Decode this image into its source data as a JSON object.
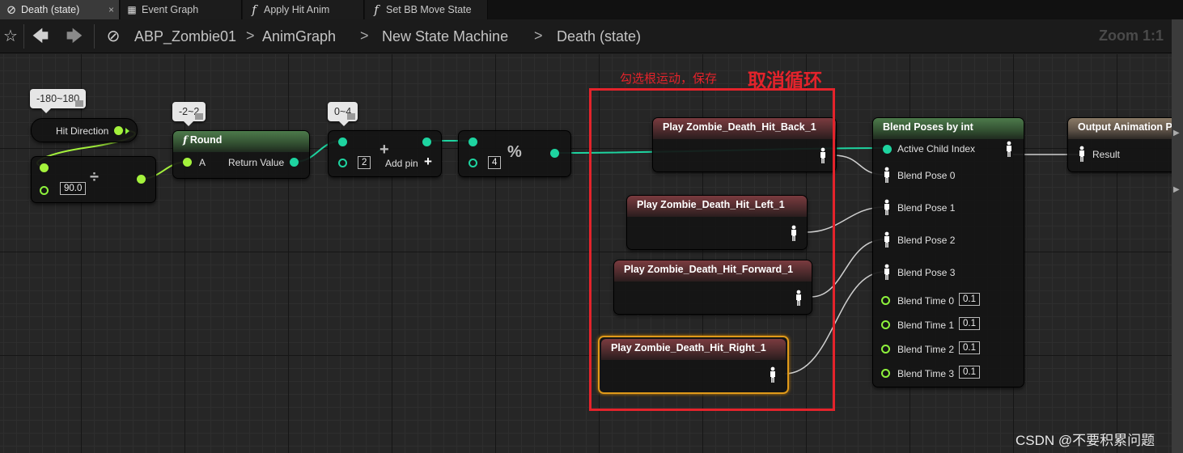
{
  "tabs": [
    {
      "label": "Death (state)",
      "icon": "state-icon",
      "active": true
    },
    {
      "label": "Event Graph",
      "icon": "event-graph-icon"
    },
    {
      "label": "Apply Hit Anim",
      "icon": "function-icon",
      "glyph": "f"
    },
    {
      "label": "Set BB Move State",
      "icon": "function-icon",
      "glyph": "f"
    }
  ],
  "breadcrumb": {
    "items": [
      "ABP_Zombie01",
      "AnimGraph",
      "New State Machine",
      "Death (state)"
    ],
    "separator": ">",
    "zoom": "Zoom 1:1"
  },
  "comments": {
    "direction_range": "-180~180",
    "round_range": "-2~2",
    "add_range": "0~4"
  },
  "nodes": {
    "hit_direction": {
      "label": "Hit Direction"
    },
    "divide": {
      "symbol": "÷",
      "value": "90.0"
    },
    "round": {
      "glyph": "f",
      "title": "Round",
      "input": "A",
      "output": "Return Value"
    },
    "add": {
      "symbol": "+",
      "value": "2",
      "add_pin": "Add pin"
    },
    "modulo": {
      "symbol": "%",
      "value": "4"
    },
    "plays": [
      {
        "title": "Play Zombie_Death_Hit_Back_1"
      },
      {
        "title": "Play Zombie_Death_Hit_Left_1"
      },
      {
        "title": "Play Zombie_Death_Hit_Forward_1"
      },
      {
        "title": "Play Zombie_Death_Hit_Right_1"
      }
    ],
    "blend": {
      "title": "Blend Poses by int",
      "active_child": "Active Child Index",
      "poses": [
        "Blend Pose 0",
        "Blend Pose 1",
        "Blend Pose 2",
        "Blend Pose 3"
      ],
      "times": [
        {
          "label": "Blend Time 0",
          "value": "0.1"
        },
        {
          "label": "Blend Time 1",
          "value": "0.1"
        },
        {
          "label": "Blend Time 2",
          "value": "0.1"
        },
        {
          "label": "Blend Time 3",
          "value": "0.1"
        }
      ]
    },
    "output": {
      "title": "Output Animation Pose",
      "result": "Result"
    }
  },
  "annotations": {
    "small": "勾选根运动，保存",
    "big": "取消循环",
    "color": "#e4232b"
  },
  "watermark": "CSDN @不要积累问题",
  "colors": {
    "exec_pin": "#1ed4a0",
    "float_pin": "#a4f23c",
    "selected_outline": "#e09a1a"
  }
}
